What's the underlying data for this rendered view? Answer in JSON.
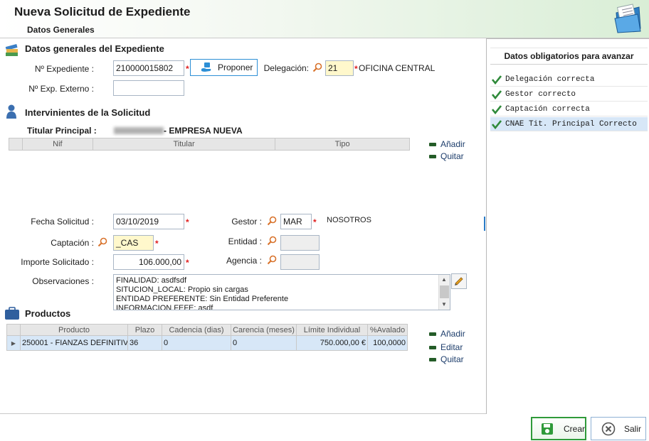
{
  "header": {
    "title": "Nueva Solicitud de Expediente",
    "subtitle": "Datos Generales",
    "icon": "folder-icon"
  },
  "datos_generales": {
    "section_title": "Datos generales del Expediente",
    "expediente_label": "Nº Expediente :",
    "expediente_value": "210000015802",
    "proponer_label": "Proponer",
    "delegacion_label": "Delegación:",
    "delegacion_code": "21",
    "delegacion_name": "OFICINA CENTRAL",
    "exp_externo_label": "Nº Exp. Externo :",
    "exp_externo_value": ""
  },
  "intervinientes": {
    "section_title": "Intervinientes de la Solicitud",
    "titular_label": "Titular Principal :",
    "titular_value": "- EMPRESA NUEVA",
    "columns": [
      "Nif",
      "Titular",
      "Tipo"
    ],
    "add_label": "Añadir",
    "remove_label": "Quitar"
  },
  "solicitud": {
    "fecha_label": "Fecha Solicitud :",
    "fecha_value": "03/10/2019",
    "captacion_label": "Captación :",
    "captacion_value": "_CAS",
    "importe_label": "Importe Solicitado :",
    "importe_value": "106.000,00",
    "gestor_label": "Gestor :",
    "gestor_code": "MAR",
    "gestor_name": "NOSOTROS",
    "entidad_label": "Entidad :",
    "entidad_value": "",
    "agencia_label": "Agencia :",
    "agencia_value": "",
    "observaciones_label": "Observaciones :",
    "observaciones_lines": [
      "FINALIDAD: asdfsdf",
      "SITUCION_LOCAL: Propio sin cargas",
      "ENTIDAD PREFERENTE: Sin Entidad Preferente",
      "INFORMACION FEFE: asdf"
    ]
  },
  "productos": {
    "section_title": "Productos",
    "columns": [
      "Producto",
      "Plazo",
      "Cadencia (dias)",
      "Carencia (meses)",
      "Límite Individual",
      "%Avalado"
    ],
    "rows": [
      {
        "producto": "250001 - FIANZAS DEFINITIV...",
        "plazo": "36",
        "cadencia": "0",
        "carencia": "0",
        "limite": "750.000,00 €",
        "avalado": "100,0000"
      }
    ],
    "add_label": "Añadir",
    "edit_label": "Editar",
    "remove_label": "Quitar"
  },
  "right_panel": {
    "title": "Datos obligatorios para avanzar",
    "items": [
      "Delegación correcta",
      "Gestor correcto",
      "Captación correcta",
      "CNAE Tit. Principal Correcto"
    ]
  },
  "footer": {
    "crear_label": "Crear",
    "salir_label": "Salir"
  },
  "colors": {
    "required": "#e02020",
    "accent_blue": "#2d8fd6",
    "selection": "#d7e7f7",
    "check_green": "#2f8a3a",
    "yellow_field": "#fff8cc"
  }
}
